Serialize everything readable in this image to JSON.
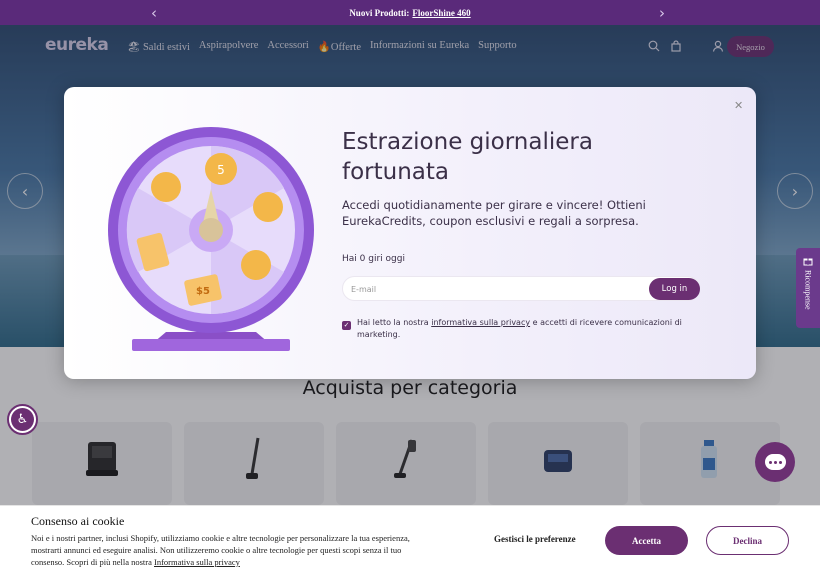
{
  "announcement": {
    "prefix": "Nuovi Prodotti:",
    "link": "FloorShine 460",
    "prev_icon": "chevron-left-icon",
    "next_icon": "chevron-right-icon"
  },
  "header": {
    "logo": "eureka",
    "menu": [
      "🏖 Saldi estivi",
      "Aspirapolvere",
      "Accessori",
      "🔥Offerte",
      "Informazioni su Eureka",
      "Supporto"
    ],
    "icons": [
      "search-icon",
      "bag-icon",
      "user-icon"
    ],
    "store_button": "Negozio"
  },
  "rewards_tab": {
    "label": "Ricompense",
    "icon": "gift-icon"
  },
  "modal": {
    "title": "Estrazione giornaliera fortunata",
    "description": "Accedi quotidianamente per girare e vincere! Ottieni EurekaCredits, coupon esclusivi e regali a sorpresa.",
    "spins": "Hai 0 giri oggi",
    "email_placeholder": "E-mail",
    "login_button": "Log in",
    "consent_prefix": "Hai letto la nostra",
    "consent_link": "informativa sulla privacy",
    "consent_suffix": "e accetti di ricevere comunicazioni di marketing.",
    "close_icon": "close-icon",
    "wheel": {
      "coin_label": "5",
      "coupon_label": "$5"
    }
  },
  "categories": {
    "title": "Acquista per categoria",
    "count": 5
  },
  "cookie_banner": {
    "title": "Consenso ai cookie",
    "text": "Noi e i nostri partner, inclusi Shopify, utilizziamo cookie e altre tecnologie per personalizzare la tua esperienza, mostrarti annunci ed eseguire analisi. Non utilizzeremo cookie o altre tecnologie per questi scopi senza il tuo consenso. Scopri di più nella nostra",
    "link": "Informativa sulla privacy",
    "manage": "Gestisci le preferenze",
    "accept": "Accetta",
    "decline": "Declina"
  },
  "colors": {
    "brand": "#6b2f72",
    "announcement": "#5a2a7a"
  }
}
